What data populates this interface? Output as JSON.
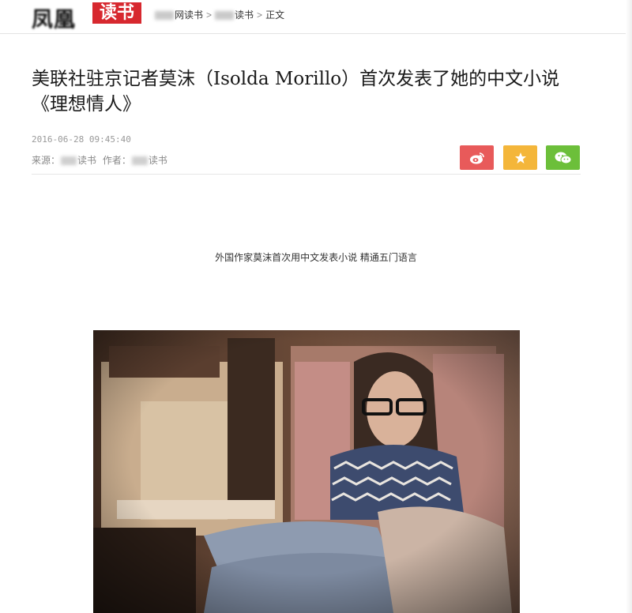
{
  "header": {
    "logo_text": "凤凰",
    "logo_badge": "读书",
    "breadcrumb": {
      "item1_suffix": "网读书",
      "item2_suffix": "读书",
      "current": "正文",
      "separator": ">"
    }
  },
  "article": {
    "title": "美联社驻京记者莫沫（Isolda Morillo）首次发表了她的中文小说《理想情人》",
    "date": "2016-06-28 09:45:40",
    "source_label": "来源：",
    "source_suffix": "读书",
    "author_label": "作者：",
    "author_suffix": "读书",
    "caption": "外国作家莫沫首次用中文发表小说 精通五门语言"
  },
  "share": {
    "weibo_icon": "weibo-icon",
    "favorite_icon": "star-icon",
    "wechat_icon": "wechat-icon",
    "colors": {
      "weibo": "#e85a5a",
      "favorite": "#f4b63a",
      "wechat": "#6cbf3a"
    }
  },
  "brand": {
    "red": "#d7282f"
  }
}
